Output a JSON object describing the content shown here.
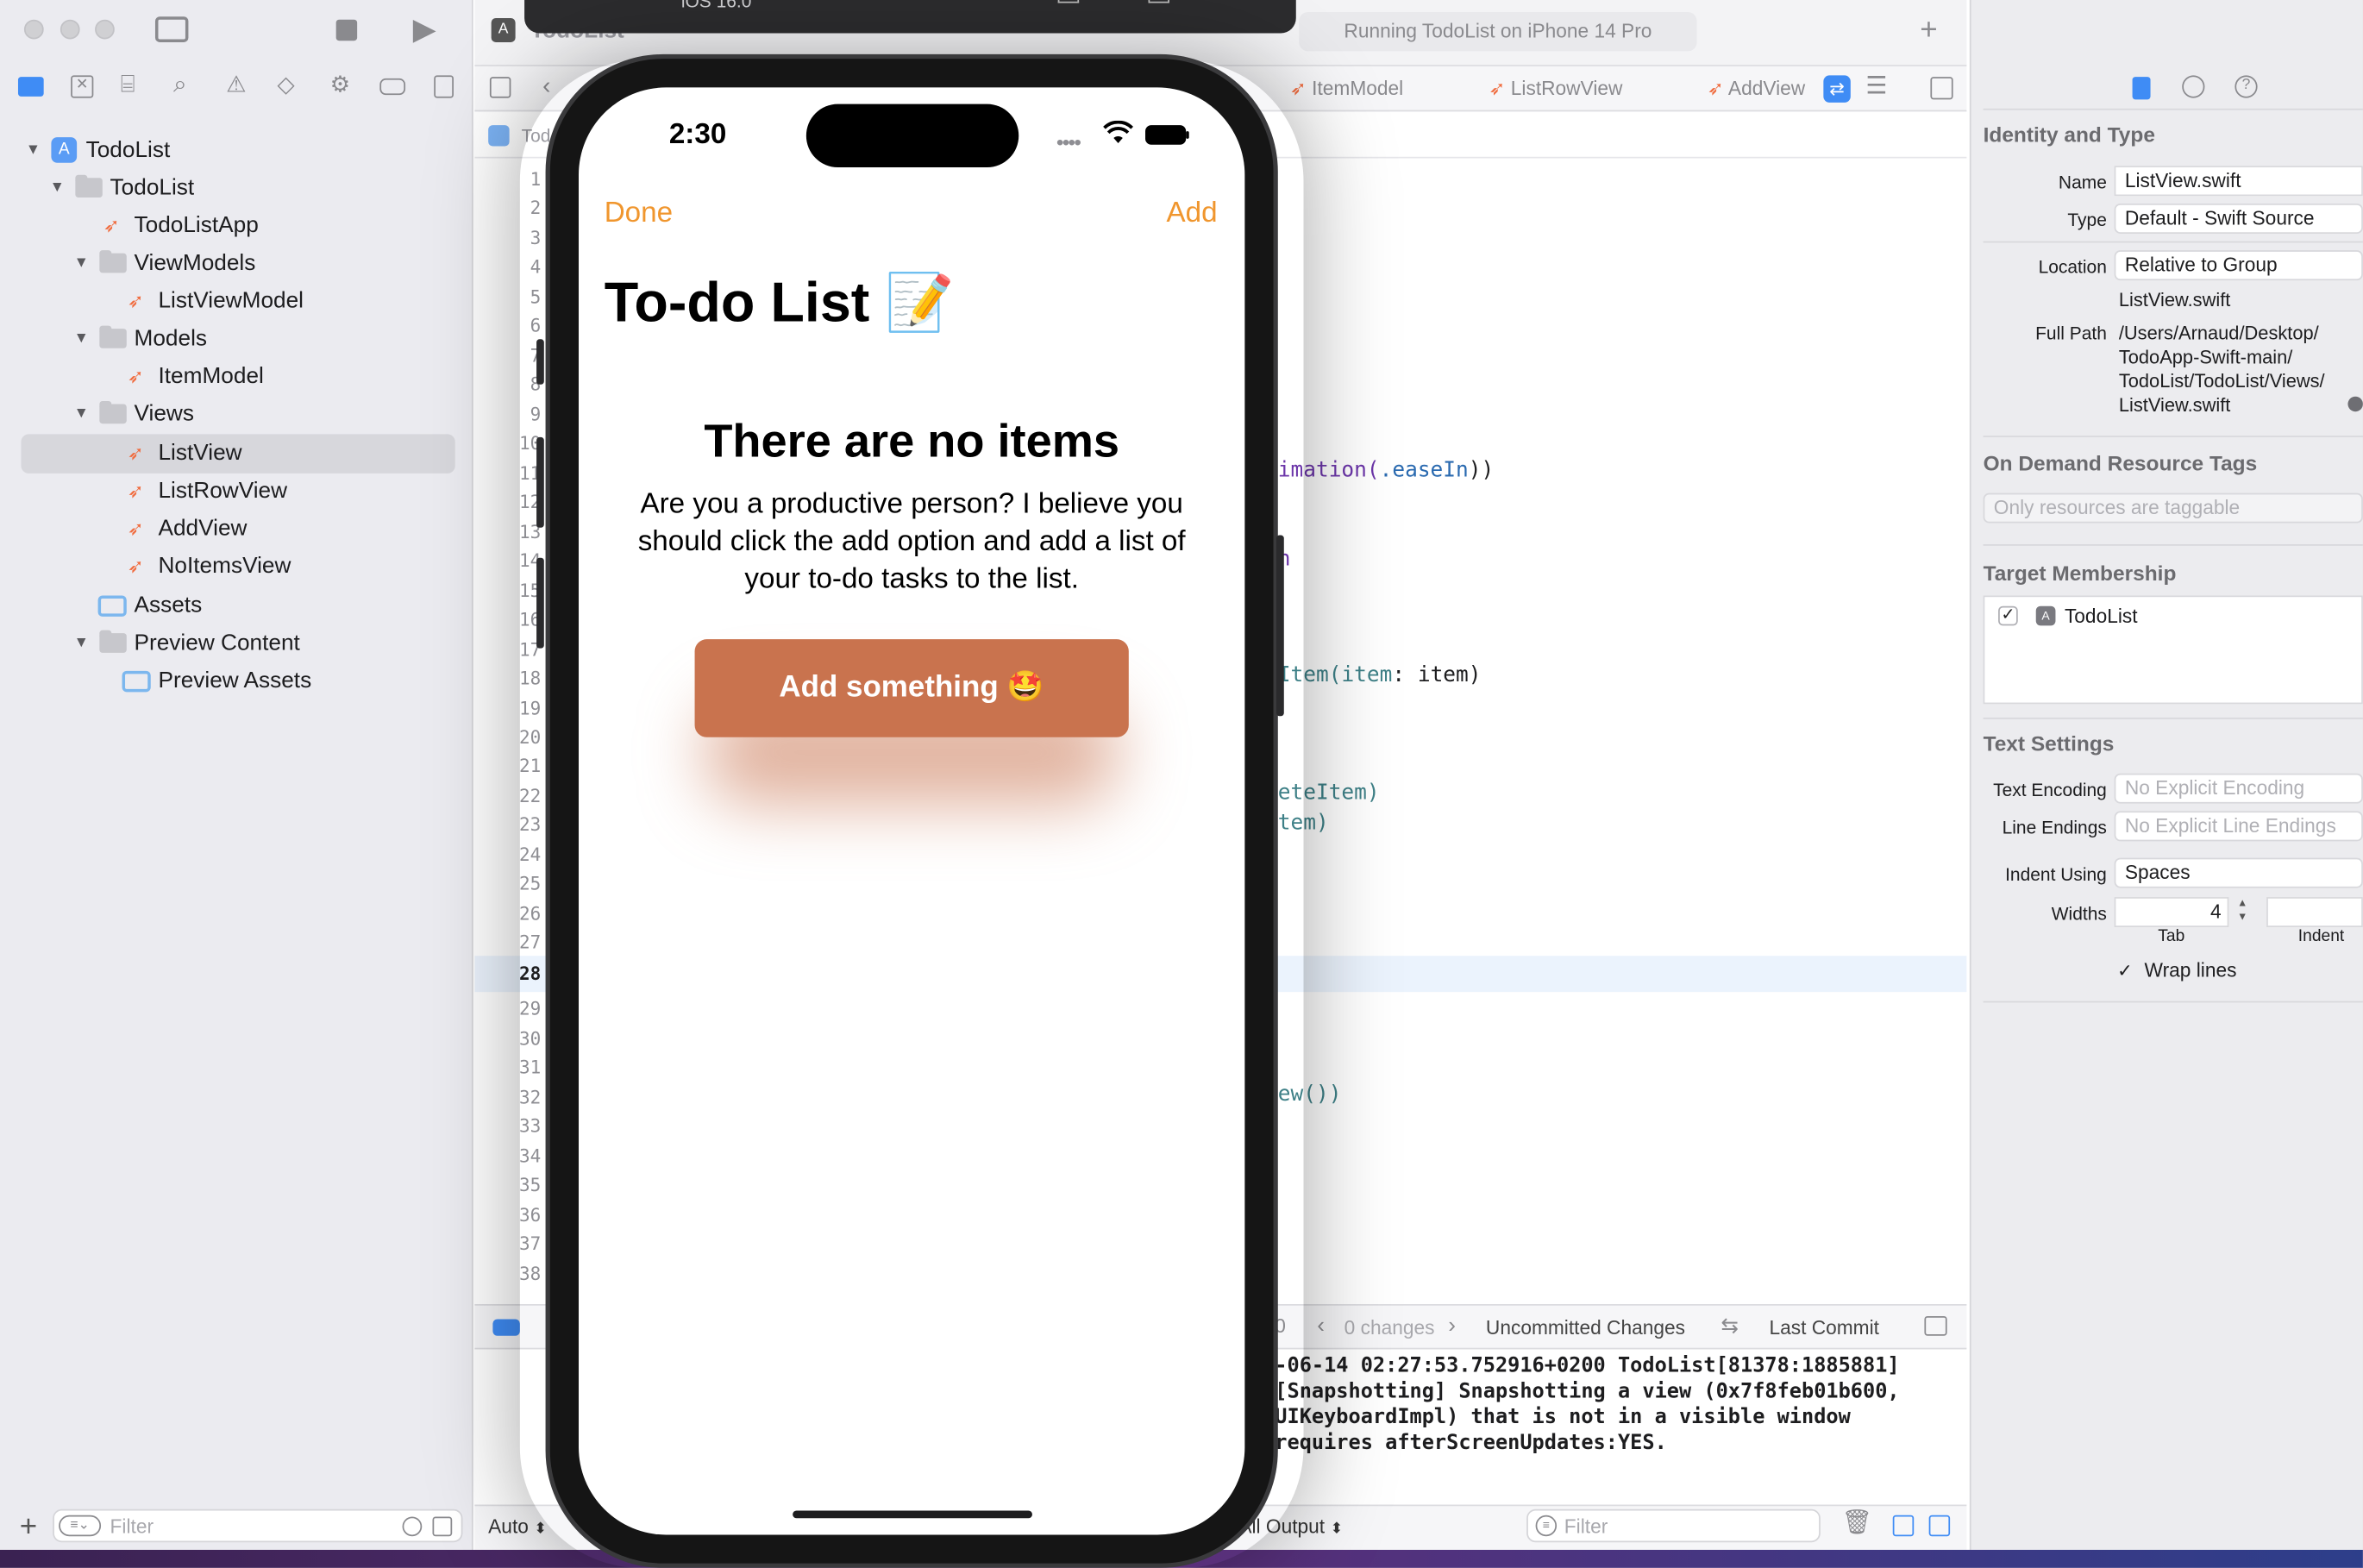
{
  "toolbar": {
    "tab_title": "TodoList",
    "status_text": "Running TodoList on iPhone 14 Pro",
    "simulator_header": "iOS 16.0"
  },
  "sidebar": {
    "tree": [
      {
        "label": "TodoList"
      },
      {
        "label": "TodoList"
      },
      {
        "label": "TodoListApp"
      },
      {
        "label": "ViewModels"
      },
      {
        "label": "ListViewModel"
      },
      {
        "label": "Models"
      },
      {
        "label": "ItemModel"
      },
      {
        "label": "Views"
      },
      {
        "label": "ListView"
      },
      {
        "label": "ListRowView"
      },
      {
        "label": "AddView"
      },
      {
        "label": "NoItemsView"
      },
      {
        "label": "Assets"
      },
      {
        "label": "Preview Content"
      },
      {
        "label": "Preview Assets"
      }
    ],
    "filter_placeholder": "Filter"
  },
  "editor": {
    "tabs": [
      "ItemModel",
      "ListRowView",
      "AddView"
    ],
    "breadcrumb_partial": "Tod",
    "line_numbers": [
      "1",
      "2",
      "3",
      "4",
      "5",
      "6",
      "7",
      "8",
      "9",
      "10",
      "11",
      "12",
      "13",
      "14",
      "15",
      "16",
      "17",
      "18",
      "19",
      "20",
      "21",
      "22",
      "23",
      "24",
      "25",
      "26",
      "27",
      "28",
      "29",
      "30",
      "31",
      "32",
      "33",
      "34",
      "35",
      "36",
      "37",
      "38"
    ],
    "current_line": "28",
    "code_fragments": {
      "l11a": "imation(",
      "l11b": ".easeIn",
      "l11c": "))",
      "l14": "h",
      "l18a": "Item(",
      "l18b": "item",
      "l18c": ": item)",
      "l22": "eteItem)",
      "l23": "tem)",
      "l32": "ew())"
    },
    "scm_bar": {
      "zero": "0",
      "changes": "0 changes",
      "uncommitted": "Uncommitted Changes",
      "last_commit": "Last Commit"
    },
    "console_lines": [
      "-06-14 02:27:53.752916+0200 TodoList[81378:1885881]",
      "[Snapshotting] Snapshotting a view (0x7f8feb01b600,",
      "UIKeyboardImpl) that is not in a visible window",
      "requires afterScreenUpdates:YES."
    ],
    "auto_label": "Auto",
    "output_label": "All Output",
    "console_filter_placeholder": "Filter"
  },
  "inspector": {
    "identity_title": "Identity and Type",
    "name_label": "Name",
    "name_value": "ListView.swift",
    "type_label": "Type",
    "type_value": "Default - Swift Source",
    "location_label": "Location",
    "location_value": "Relative to Group",
    "location_file": "ListView.swift",
    "fullpath_label": "Full Path",
    "fullpath_lines": [
      "/Users/Arnaud/Desktop/",
      "TodoApp-Swift-main/",
      "TodoList/TodoList/Views/",
      "ListView.swift"
    ],
    "odr_title": "On Demand Resource Tags",
    "odr_placeholder": "Only resources are taggable",
    "target_title": "Target Membership",
    "target_item": "TodoList",
    "text_settings_title": "Text Settings",
    "encoding_label": "Text Encoding",
    "encoding_value": "No Explicit Encoding",
    "line_endings_label": "Line Endings",
    "line_endings_value": "No Explicit Line Endings",
    "indent_label": "Indent Using",
    "indent_value": "Spaces",
    "widths_label": "Widths",
    "tab_width": "4",
    "tab_caption": "Tab",
    "indent_caption": "Indent",
    "wrap_label": "Wrap lines"
  },
  "phone": {
    "time": "2:30",
    "done_label": "Done",
    "add_label": "Add",
    "nav_title": "To-do List 📝",
    "empty_title": "There are no items",
    "empty_body": "Are you a productive person? I believe you should click the add option and add a list of your to-do tasks to the list.",
    "cta_label": "Add something 🤩"
  },
  "colors": {
    "accent_orange": "#F0962E",
    "cta_button": "#C9734E",
    "xcode_blue": "#3F8CF5"
  }
}
